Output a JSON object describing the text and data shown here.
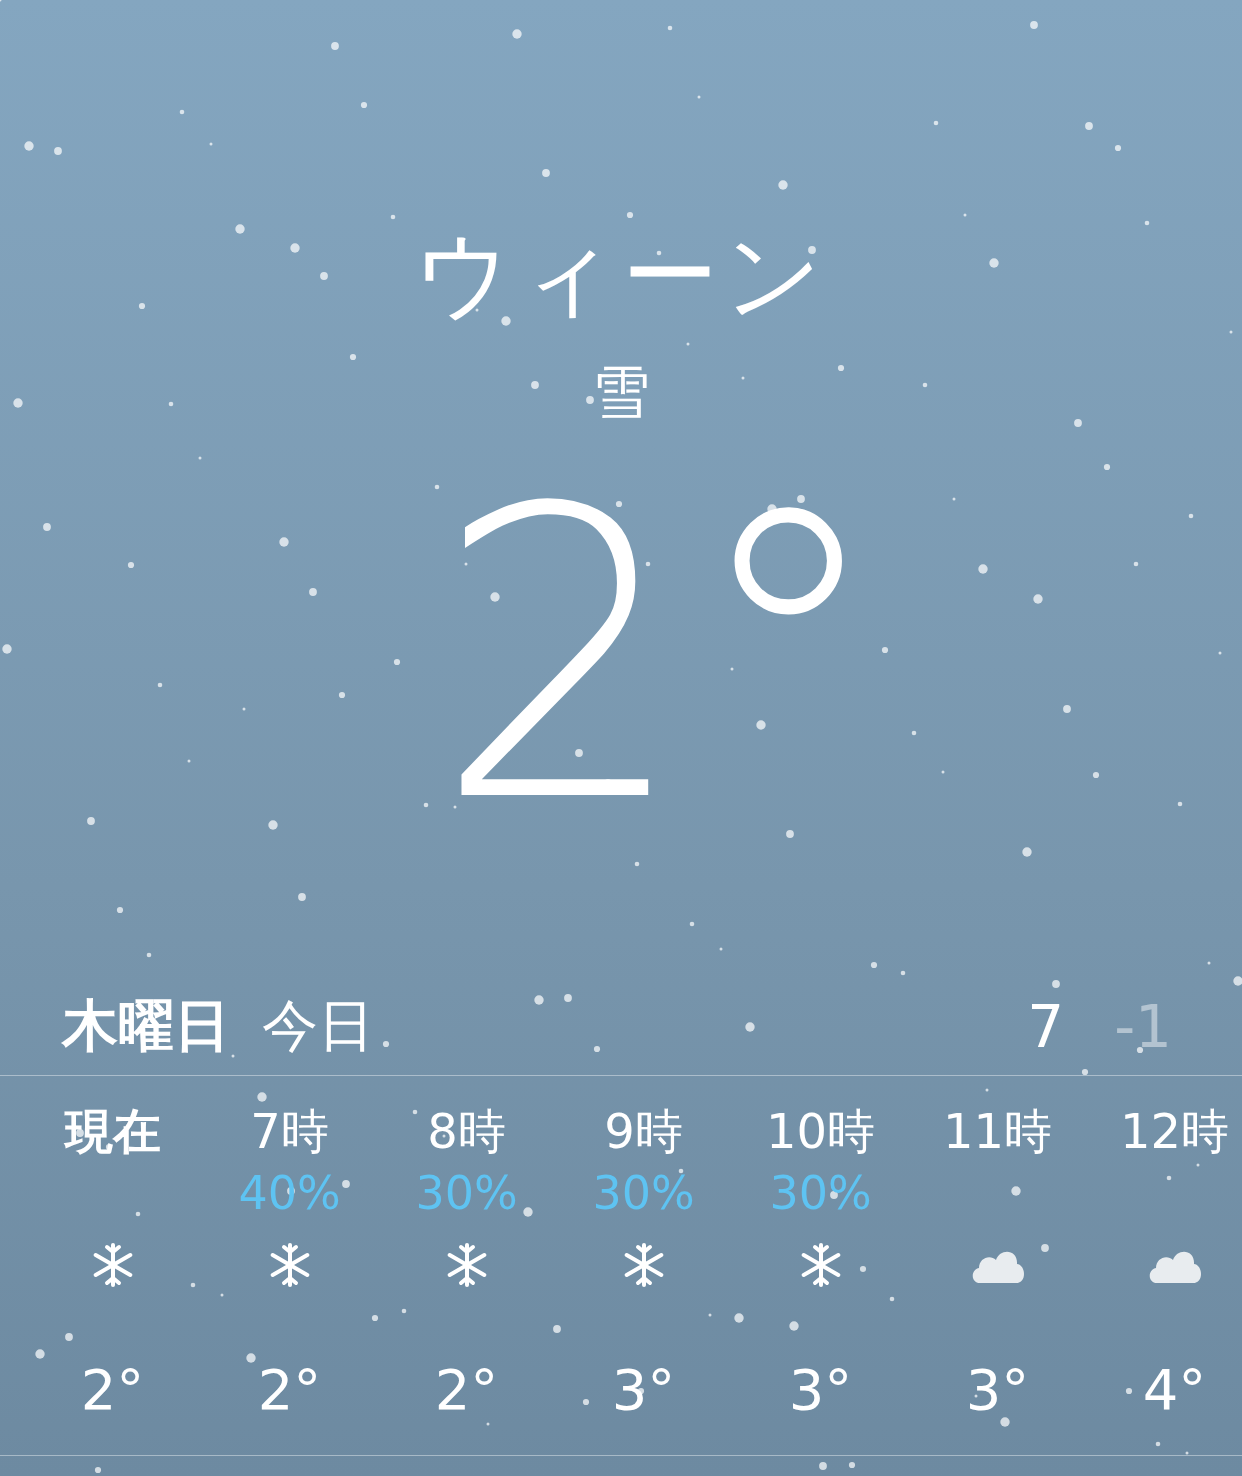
{
  "location": {
    "city": "ウィーン",
    "condition": "雪",
    "temperature": "2°"
  },
  "today": {
    "day": "木曜日",
    "label": "今日",
    "high": "7",
    "low": "-1"
  },
  "hourly": [
    {
      "time": "現在",
      "current": true,
      "kind": "snow",
      "temp": "2°"
    },
    {
      "time": "7時",
      "current": false,
      "precip": "40%",
      "kind": "snow",
      "temp": "2°"
    },
    {
      "time": "8時",
      "current": false,
      "precip": "30%",
      "kind": "snow",
      "temp": "2°"
    },
    {
      "time": "9時",
      "current": false,
      "precip": "30%",
      "kind": "snow",
      "temp": "3°"
    },
    {
      "time": "10時",
      "current": false,
      "precip": "30%",
      "kind": "snow",
      "temp": "3°"
    },
    {
      "time": "11時",
      "current": false,
      "kind": "cloud",
      "temp": "3°"
    },
    {
      "time": "12時",
      "current": false,
      "kind": "cloud",
      "temp": "4°"
    }
  ]
}
